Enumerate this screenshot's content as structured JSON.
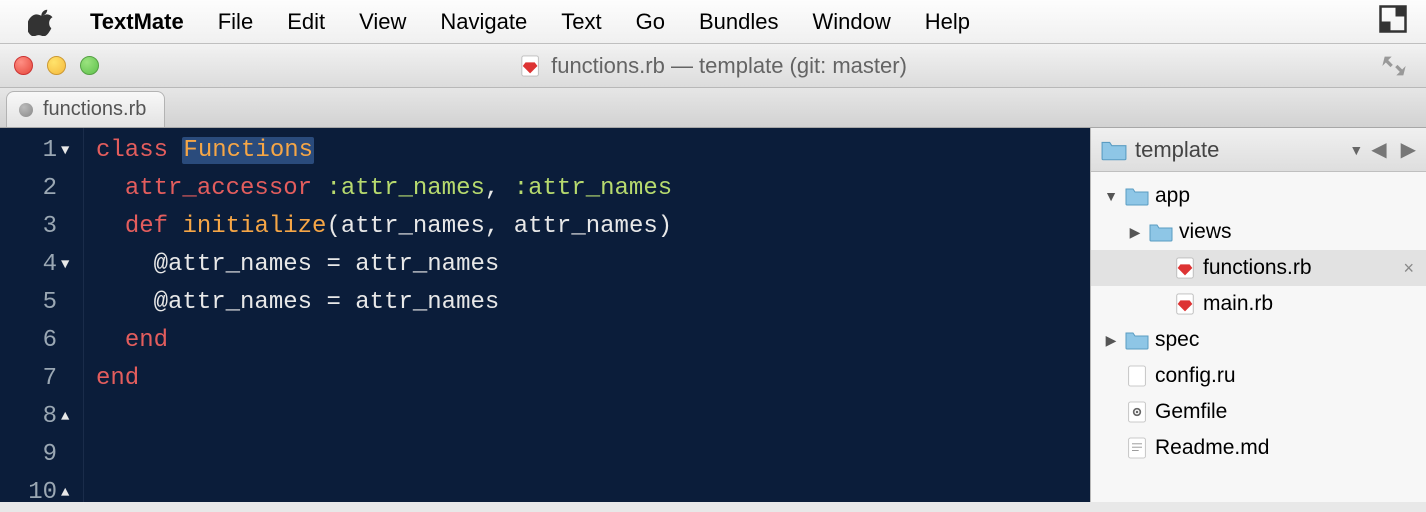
{
  "menubar": {
    "app_name": "TextMate",
    "items": [
      "File",
      "Edit",
      "View",
      "Navigate",
      "Text",
      "Go",
      "Bundles",
      "Window",
      "Help"
    ]
  },
  "titlebar": {
    "title": "functions.rb — template (git: master)"
  },
  "tabs": [
    {
      "label": "functions.rb"
    }
  ],
  "editor": {
    "lines": [
      {
        "num": 1,
        "fold": "▼",
        "tokens": [
          {
            "t": "class",
            "c": "tok-keyword"
          },
          {
            "t": " ",
            "c": ""
          },
          {
            "t": "Functions",
            "c": "tok-classname tok-cursor-box"
          }
        ]
      },
      {
        "num": 2,
        "fold": "",
        "tokens": [
          {
            "t": "  ",
            "c": ""
          },
          {
            "t": "attr_accessor",
            "c": "tok-keyword"
          },
          {
            "t": " ",
            "c": ""
          },
          {
            "t": ":attr_names",
            "c": "tok-symbol"
          },
          {
            "t": ", ",
            "c": "tok-punct"
          },
          {
            "t": ":attr_names",
            "c": "tok-symbol"
          }
        ]
      },
      {
        "num": 3,
        "fold": "",
        "tokens": [
          {
            "t": "",
            "c": ""
          }
        ]
      },
      {
        "num": 4,
        "fold": "▼",
        "tokens": [
          {
            "t": "  ",
            "c": ""
          },
          {
            "t": "def",
            "c": "tok-keyword"
          },
          {
            "t": " ",
            "c": ""
          },
          {
            "t": "initialize",
            "c": "tok-method"
          },
          {
            "t": "(",
            "c": "tok-punct"
          },
          {
            "t": "attr_names",
            "c": "tok-ident"
          },
          {
            "t": ", ",
            "c": "tok-punct"
          },
          {
            "t": "attr_names",
            "c": "tok-ident"
          },
          {
            "t": ")",
            "c": "tok-punct"
          }
        ]
      },
      {
        "num": 5,
        "fold": "",
        "tokens": [
          {
            "t": "    ",
            "c": ""
          },
          {
            "t": "@attr_names",
            "c": "tok-ivar"
          },
          {
            "t": " = ",
            "c": "tok-punct"
          },
          {
            "t": "attr_names",
            "c": "tok-ident"
          }
        ]
      },
      {
        "num": 6,
        "fold": "",
        "tokens": [
          {
            "t": "    ",
            "c": ""
          },
          {
            "t": "@attr_names",
            "c": "tok-ivar"
          },
          {
            "t": " = ",
            "c": "tok-punct"
          },
          {
            "t": "attr_names",
            "c": "tok-ident"
          }
        ]
      },
      {
        "num": 7,
        "fold": "",
        "tokens": [
          {
            "t": "",
            "c": ""
          }
        ]
      },
      {
        "num": 8,
        "fold": "▲",
        "tokens": [
          {
            "t": "  ",
            "c": ""
          },
          {
            "t": "end",
            "c": "tok-keyword"
          }
        ]
      },
      {
        "num": 9,
        "fold": "",
        "tokens": [
          {
            "t": "",
            "c": ""
          }
        ]
      },
      {
        "num": 10,
        "fold": "▲",
        "tokens": [
          {
            "t": "end",
            "c": "tok-keyword"
          }
        ]
      }
    ]
  },
  "sidebar": {
    "title": "template",
    "tree": [
      {
        "name": "app",
        "type": "folder",
        "depth": 1,
        "disclosure": "▼",
        "selected": false
      },
      {
        "name": "views",
        "type": "folder",
        "depth": 2,
        "disclosure": "▶",
        "selected": false
      },
      {
        "name": "functions.rb",
        "type": "ruby",
        "depth": 3,
        "disclosure": "",
        "selected": true,
        "closable": true
      },
      {
        "name": "main.rb",
        "type": "ruby",
        "depth": 3,
        "disclosure": "",
        "selected": false
      },
      {
        "name": "spec",
        "type": "folder",
        "depth": 1,
        "disclosure": "▶",
        "selected": false
      },
      {
        "name": "config.ru",
        "type": "file",
        "depth": 1,
        "disclosure": "",
        "selected": false
      },
      {
        "name": "Gemfile",
        "type": "gear",
        "depth": 1,
        "disclosure": "",
        "selected": false
      },
      {
        "name": "Readme.md",
        "type": "text",
        "depth": 1,
        "disclosure": "",
        "selected": false
      }
    ]
  }
}
